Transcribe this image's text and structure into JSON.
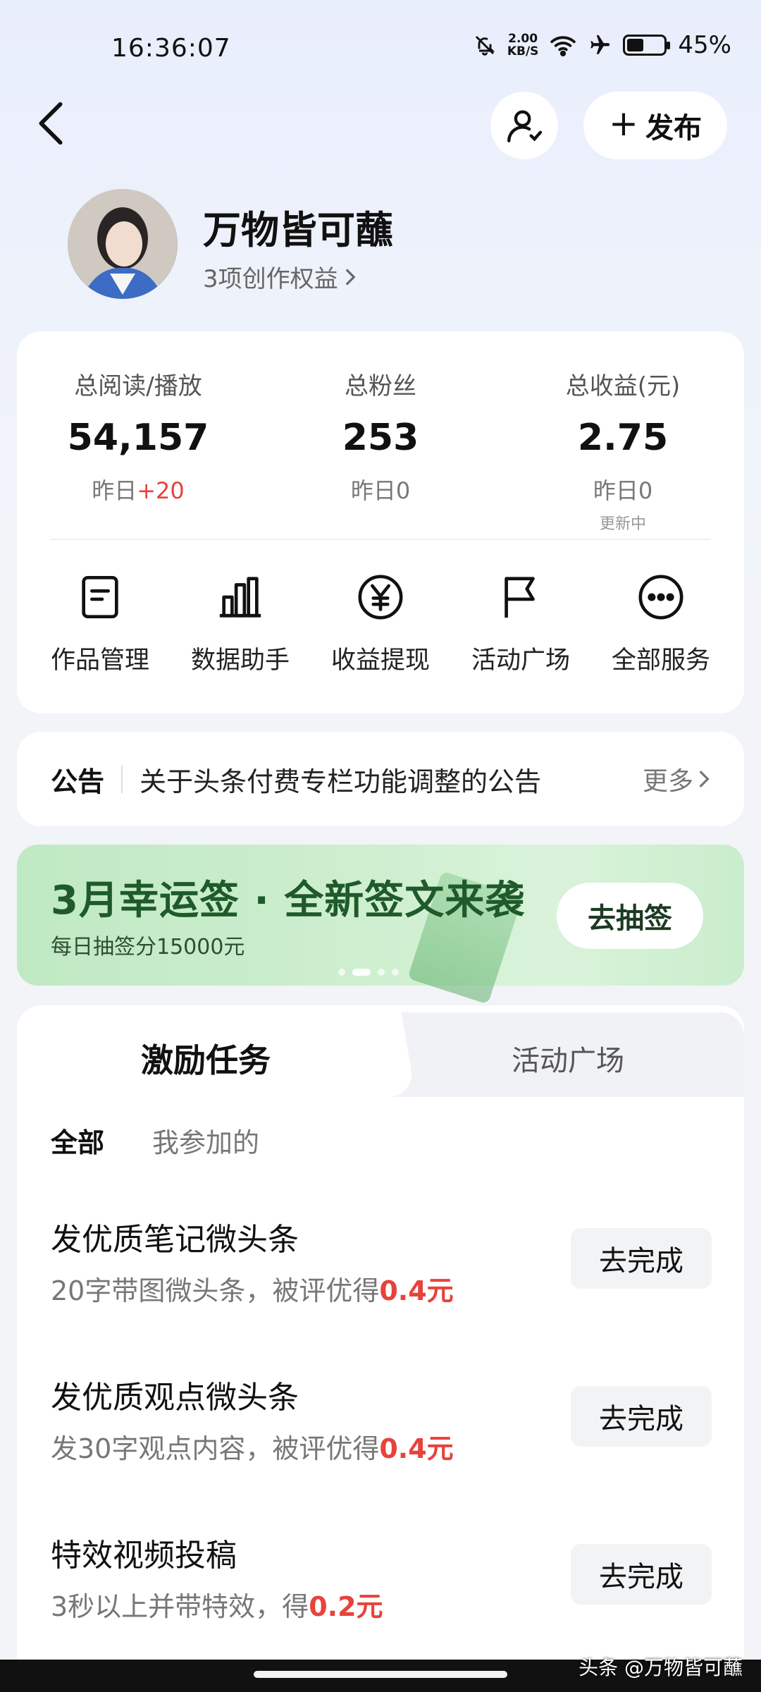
{
  "status_bar": {
    "time": "16:36:07",
    "net_speed_value": "2.00",
    "net_speed_unit": "KB/S",
    "battery": "45%",
    "battery_level": 0.45,
    "icons": [
      "mute-icon",
      "wifi-icon",
      "airplane-icon",
      "battery-icon"
    ]
  },
  "header": {
    "publish_label": "发布"
  },
  "profile": {
    "name": "万物皆可蘸",
    "rights": "3项创作权益"
  },
  "stats": [
    {
      "label": "总阅读/播放",
      "value": "54,157",
      "yday_prefix": "昨日",
      "yday_value": "+20",
      "note": ""
    },
    {
      "label": "总粉丝",
      "value": "253",
      "yday_prefix": "昨日",
      "yday_value": "0",
      "note": ""
    },
    {
      "label": "总收益(元)",
      "value": "2.75",
      "yday_prefix": "昨日",
      "yday_value": "0",
      "note": "更新中"
    }
  ],
  "services": [
    {
      "label": "作品管理",
      "icon": "document-icon"
    },
    {
      "label": "数据助手",
      "icon": "bar-chart-icon"
    },
    {
      "label": "收益提现",
      "icon": "yen-icon"
    },
    {
      "label": "活动广场",
      "icon": "flag-icon"
    },
    {
      "label": "全部服务",
      "icon": "more-icon"
    }
  ],
  "notice": {
    "title": "公告",
    "text": "关于头条付费专栏功能调整的公告",
    "more": "更多"
  },
  "banner": {
    "title": "3月幸运签 · 全新签文来袭",
    "subtitle": "每日抽签分15000元",
    "button": "去抽签",
    "accent": "#1f5a2a"
  },
  "tabs": {
    "active": "激励任务",
    "inactive": "活动广场"
  },
  "filters": {
    "all": "全部",
    "mine": "我参加的"
  },
  "tasks": [
    {
      "title": "发优质笔记微头条",
      "desc": "20字带图微头条，被评优得",
      "amount": "0.4元",
      "button": "去完成"
    },
    {
      "title": "发优质观点微头条",
      "desc": "发30字观点内容，被评优得",
      "amount": "0.4元",
      "button": "去完成"
    },
    {
      "title": "特效视频投稿",
      "desc": "3秒以上并带特效，得",
      "amount": "0.2元",
      "button": "去完成"
    }
  ],
  "watermark": "头条 @万物皆可蘸",
  "colors": {
    "increase": "#e8423b",
    "text": "#111111"
  }
}
